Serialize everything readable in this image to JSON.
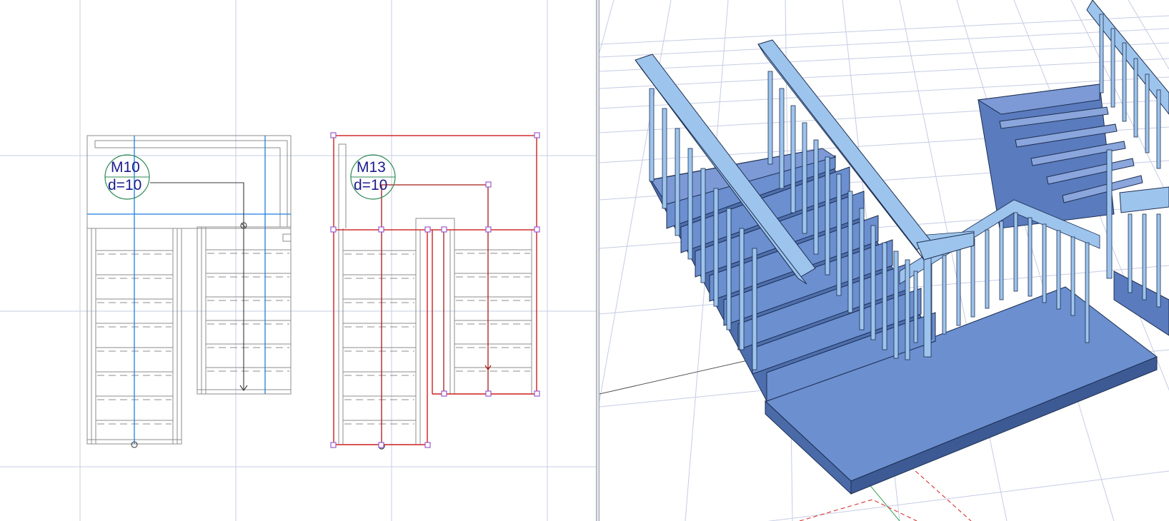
{
  "plan": {
    "stair_a": {
      "marker_id": "M10",
      "marker_param": "d=10"
    },
    "stair_b": {
      "marker_id": "M13",
      "marker_param": "d=10"
    }
  },
  "colors": {
    "grid": "#c8cce0",
    "stair_outline": "#8c8c8c",
    "walkline_blue": "#1f7fe0",
    "selection_red": "#cc1f1f",
    "hotspot": "#9b59d0",
    "marker_ring": "#2e8b57",
    "marker_text": "#1c1c8c",
    "stair_fill": "#6b8fcf",
    "rail_fill": "#9dc4ec",
    "floor_grid": "#c6cce4"
  }
}
